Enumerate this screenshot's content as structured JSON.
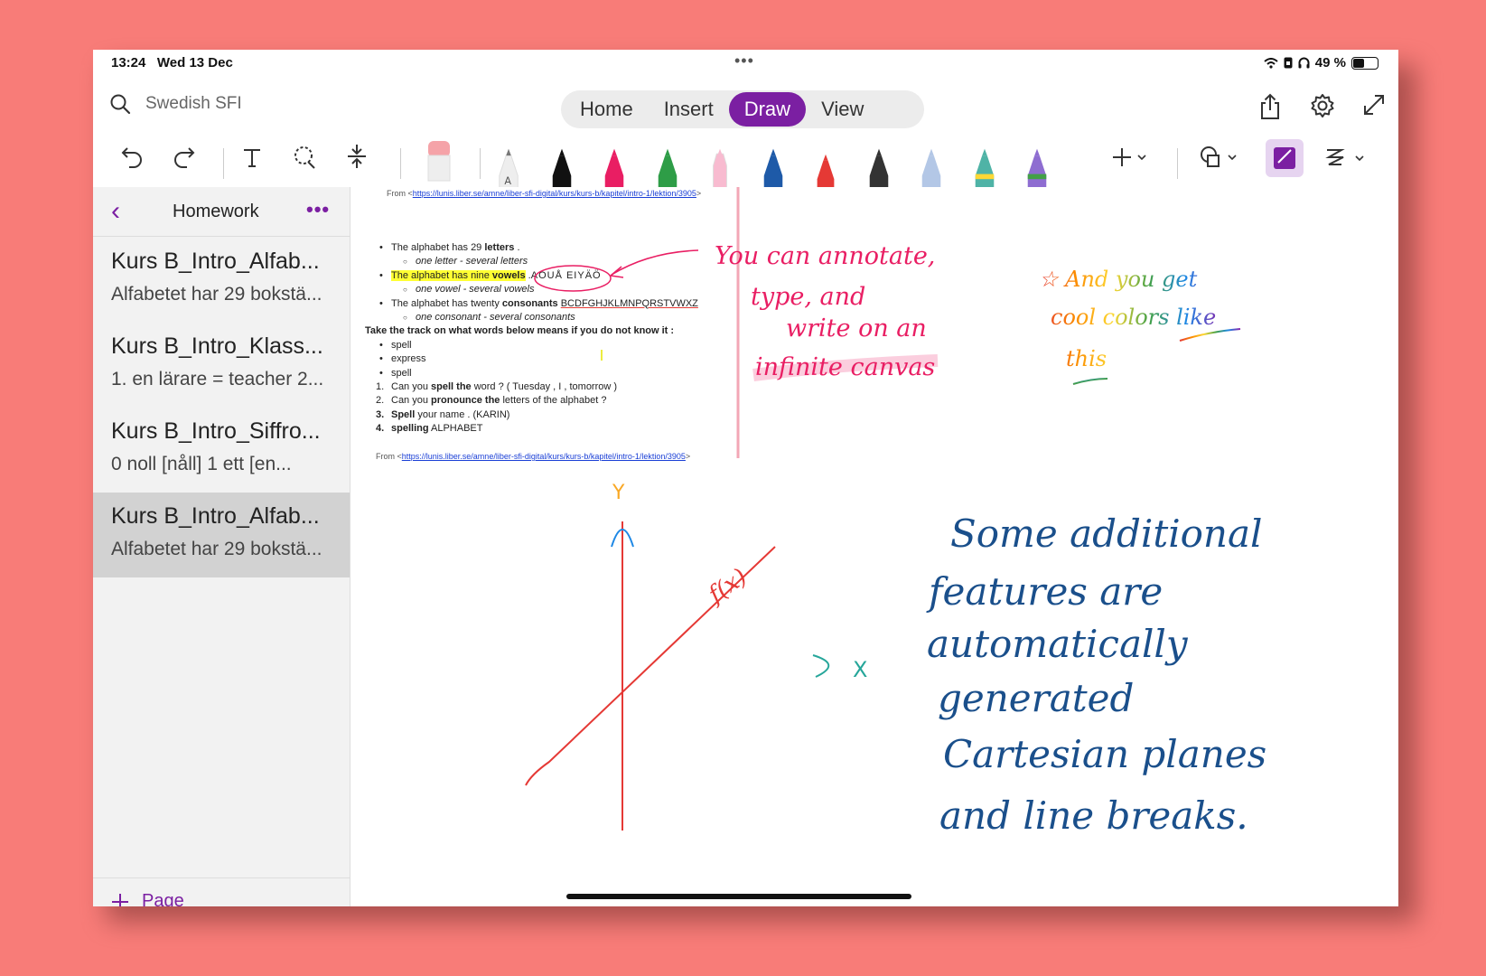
{
  "status": {
    "time": "13:24",
    "date": "Wed 13 Dec",
    "battery": "49 %",
    "battery_level": 0.49
  },
  "topbar": {
    "notebook": "Swedish SFI",
    "tabs": [
      {
        "label": "Home",
        "active": false
      },
      {
        "label": "Insert",
        "active": false
      },
      {
        "label": "Draw",
        "active": true
      },
      {
        "label": "View",
        "active": false
      }
    ]
  },
  "toolbar": {
    "tools": [
      "undo-icon",
      "redo-icon",
      "text-icon",
      "lasso-icon",
      "insert-space-icon",
      "eraser-icon"
    ],
    "pens": [
      {
        "color": "#9e9e9e",
        "kind": "pencil",
        "letter": "A"
      },
      {
        "color": "#111111",
        "kind": "pen"
      },
      {
        "color": "#e91e63",
        "kind": "pen"
      },
      {
        "color": "#2e9d47",
        "kind": "pen"
      },
      {
        "color": "#f8bbd0",
        "kind": "highlighter"
      },
      {
        "color": "#1e5aa8",
        "kind": "pen"
      },
      {
        "color": "#e53935",
        "kind": "pen-selected"
      },
      {
        "color": "#333333",
        "kind": "pen"
      },
      {
        "color": "#b3c7e6",
        "kind": "pen"
      },
      {
        "color": "#4fb3a6",
        "kind": "rainbow"
      },
      {
        "color": "#8e6dd1",
        "kind": "galaxy"
      }
    ]
  },
  "sidebar": {
    "title": "Homework",
    "pages": [
      {
        "title": "Kurs B_Intro_Alfab...",
        "preview": "Alfabetet har 29 bokstä..."
      },
      {
        "title": "Kurs B_Intro_Klass...",
        "preview": "1. en lärare = teacher  2..."
      },
      {
        "title": "Kurs B_Intro_Siffro...",
        "preview": "0  noll  [nåll]  1  ett  [en..."
      },
      {
        "title": "Kurs B_Intro_Alfab...",
        "preview": "Alfabetet har 29 bokstä...",
        "selected": true
      }
    ],
    "add_page_label": "Page"
  },
  "document": {
    "source_prefix": "From <",
    "source_url": "https://lunis.liber.se/amne/liber-sfi-digital/kurs/kurs-b/kapitel/intro-1/lektion/3905",
    "source_suffix": ">",
    "b1_pre": "The alphabet has 29 ",
    "b1_bold": "letters",
    "b1_post": " .",
    "b1_sub": "one letter - several letters",
    "b2_pre": "The alphabet has nine ",
    "b2_bold": "vowels",
    "b2_post": " .",
    "b2_letters": "AOUÅ EIYÄÖ",
    "b2_sub": "one vowel - several vowels",
    "b3_pre": "The alphabet has twenty ",
    "b3_bold": "consonants",
    "b3_letters": "BCDFGHJKLMNPQRSTVWXZ",
    "b3_sub": "one consonant - several consonants",
    "task": "Take the track on what words below means if you do not know it :",
    "words": [
      "spell",
      "express",
      "spell"
    ],
    "q1_pre": "Can you ",
    "q1_bold": "spell the",
    "q1_post": " word ? ( Tuesday , I , tomorrow )",
    "q2_pre": "Can you ",
    "q2_bold": "pronounce the",
    "q2_post": " letters of the alphabet ?",
    "q3_bold": "Spell",
    "q3_post": " your name . (KARIN)",
    "q4_bold": "spelling",
    "q4_post": " ALPHABET",
    "numbers": [
      "1.",
      "2.",
      "3.",
      "4."
    ]
  },
  "ink": {
    "note_pink": [
      "You can annotate,",
      "type, and",
      "write on an",
      "infinite canvas"
    ],
    "note_rainbow": [
      "☆ And you get",
      "cool colors like",
      "this"
    ],
    "note_blue": [
      "Some additional",
      "features are",
      "automatically",
      "generated",
      "Cartesian planes",
      "and line breaks."
    ],
    "graph_y": "Y",
    "graph_x": "X",
    "graph_fx": "f(x)"
  }
}
